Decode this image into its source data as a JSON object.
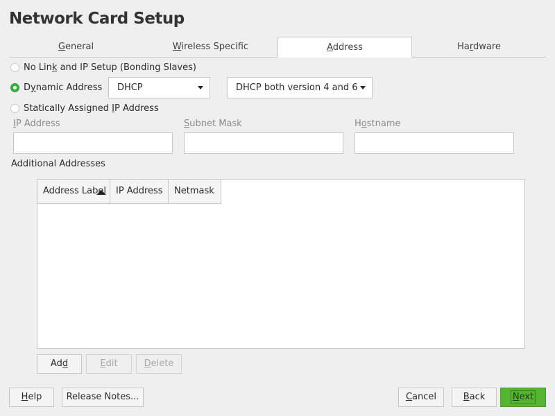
{
  "window": {
    "title": "Network Card Setup"
  },
  "tabs": [
    {
      "pre": "",
      "key": "G",
      "post": "eneral"
    },
    {
      "pre": "",
      "key": "W",
      "post": "ireless Specific"
    },
    {
      "pre": "",
      "key": "A",
      "post": "ddress"
    },
    {
      "pre": "Ha",
      "key": "r",
      "post": "dware"
    }
  ],
  "active_tab": "Address",
  "radios": {
    "no_link": {
      "pre": "No Lin",
      "key": "k",
      "post": " and IP Setup (Bonding Slaves)"
    },
    "dynamic": {
      "pre": "D",
      "key": "y",
      "post": "namic Address"
    },
    "static": {
      "pre": "Statically Assigned ",
      "key": "I",
      "post": "P Address"
    }
  },
  "selected_radio": "dynamic",
  "combos": {
    "dhcp_mode": "DHCP",
    "dhcp_version": "DHCP both version 4 and 6"
  },
  "fields": {
    "ip": {
      "key": "I",
      "post": "P Address",
      "value": ""
    },
    "subnet": {
      "key": "S",
      "post": "ubnet Mask",
      "value": ""
    },
    "hostname": {
      "pre": "H",
      "key": "o",
      "post": "stname",
      "value": ""
    }
  },
  "additional": {
    "label": "Additional Addresses",
    "columns": [
      "Address Label",
      "IP Address",
      "Netmask"
    ],
    "rows": []
  },
  "table_buttons": {
    "add": {
      "pre": "Ad",
      "key": "d",
      "post": ""
    },
    "edit": {
      "pre": "",
      "key": "E",
      "post": "dit"
    },
    "delete": {
      "pre": "",
      "key": "D",
      "post": "elete"
    }
  },
  "footer": {
    "help": {
      "pre": "",
      "key": "H",
      "post": "elp"
    },
    "release_notes": "Release Notes...",
    "cancel": {
      "pre": "",
      "key": "C",
      "post": "ancel"
    },
    "back": {
      "pre": "",
      "key": "B",
      "post": "ack"
    },
    "next": {
      "pre": "",
      "key": "N",
      "post": "ext"
    }
  },
  "colors": {
    "accent_green": "#55b430",
    "radio_checked": "#35b537",
    "background": "#efefef"
  }
}
